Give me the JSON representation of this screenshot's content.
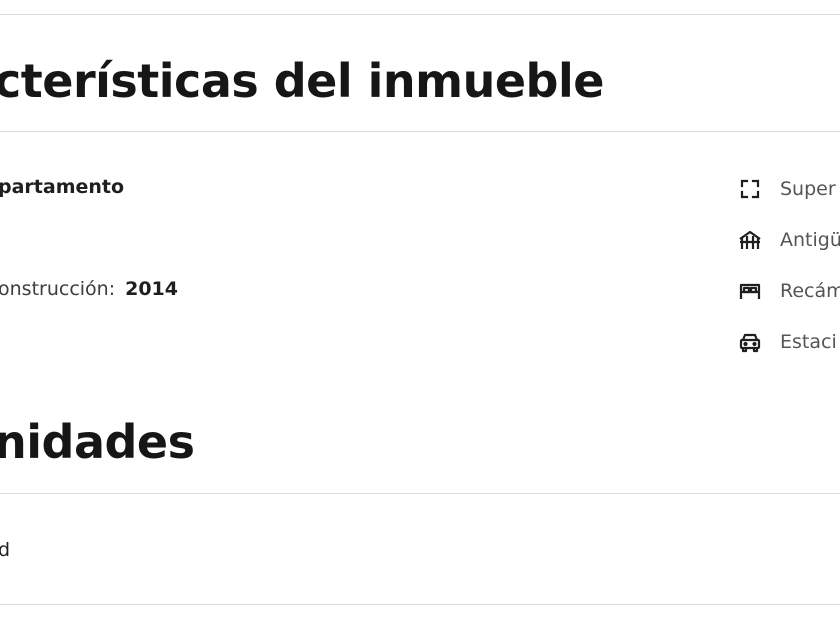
{
  "caracteristicas": {
    "title": "cterísticas del inmueble",
    "tipo": "partamento",
    "construccion_label": "onstrucción:",
    "construccion_value": "2014"
  },
  "right_features": [
    {
      "icon": "expand-icon",
      "label": "Super"
    },
    {
      "icon": "building-icon",
      "label": "Antigü"
    },
    {
      "icon": "bed-icon",
      "label": "Recám"
    },
    {
      "icon": "car-icon",
      "label": "Estaci"
    }
  ],
  "amenidades": {
    "title": "nidades",
    "items": [
      "d"
    ]
  }
}
